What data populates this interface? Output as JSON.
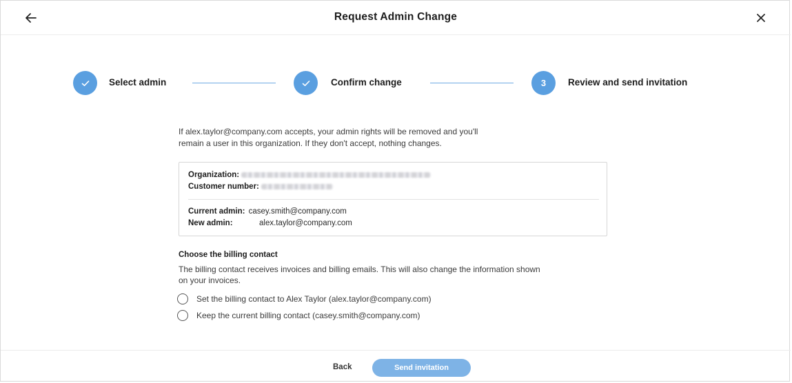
{
  "header": {
    "title": "Request Admin Change",
    "back_icon": "arrow-left-icon",
    "close_icon": "close-icon"
  },
  "stepper": {
    "accent_color": "#5a9fe0",
    "steps": [
      {
        "label": "Select admin",
        "state": "completed",
        "icon": "check-icon"
      },
      {
        "label": "Confirm change",
        "state": "completed",
        "icon": "check-icon"
      },
      {
        "label": "Review and send invitation",
        "state": "current",
        "number": "3"
      }
    ]
  },
  "intro": {
    "line1": "If alex.taylor@company.com  accepts, your admin rights will be removed and you'll",
    "line2": "remain a user in this organization. If they don't accept, nothing changes."
  },
  "details": {
    "organization_label": "Organization:",
    "customer_number_label": "Customer number:",
    "current_admin_label": "Current admin:",
    "current_admin_value": "casey.smith@company.com",
    "new_admin_label": "New admin:",
    "new_admin_value": "alex.taylor@company.com"
  },
  "billing": {
    "title": "Choose the billing contact",
    "desc_line1": "The billing contact receives invoices and billing emails. This will also change the information shown",
    "desc_line2": "on your invoices.",
    "options": [
      {
        "label": "Set the billing contact to Alex Taylor (alex.taylor@company.com)",
        "selected": false
      },
      {
        "label": "Keep the current billing contact  (casey.smith@company.com)",
        "selected": false
      }
    ]
  },
  "footer": {
    "back_label": "Back",
    "send_label": "Send invitation",
    "send_color": "#7eb3e6"
  }
}
